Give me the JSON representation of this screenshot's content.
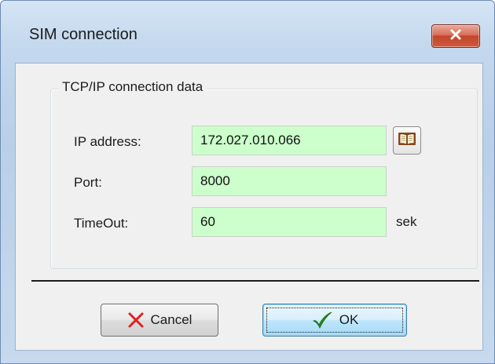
{
  "window": {
    "title": "SIM connection"
  },
  "group": {
    "title": "TCP/IP connection data",
    "fields": {
      "ip": {
        "label": "IP address:",
        "value": "172.027.010.066"
      },
      "port": {
        "label": "Port:",
        "value": "8000"
      },
      "timeout": {
        "label": "TimeOut:",
        "value": "60",
        "unit": "sek"
      }
    }
  },
  "buttons": {
    "cancel": "Cancel",
    "ok": "OK"
  },
  "icons": {
    "close": "close-icon",
    "address_book": "address-book-icon",
    "cancel": "red-x-icon",
    "ok": "green-checkmark-icon"
  },
  "colors": {
    "field_background": "#ccffcc",
    "close_button": "#c2452a",
    "cancel_icon": "#e02020",
    "ok_icon": "#2a8a1e"
  }
}
